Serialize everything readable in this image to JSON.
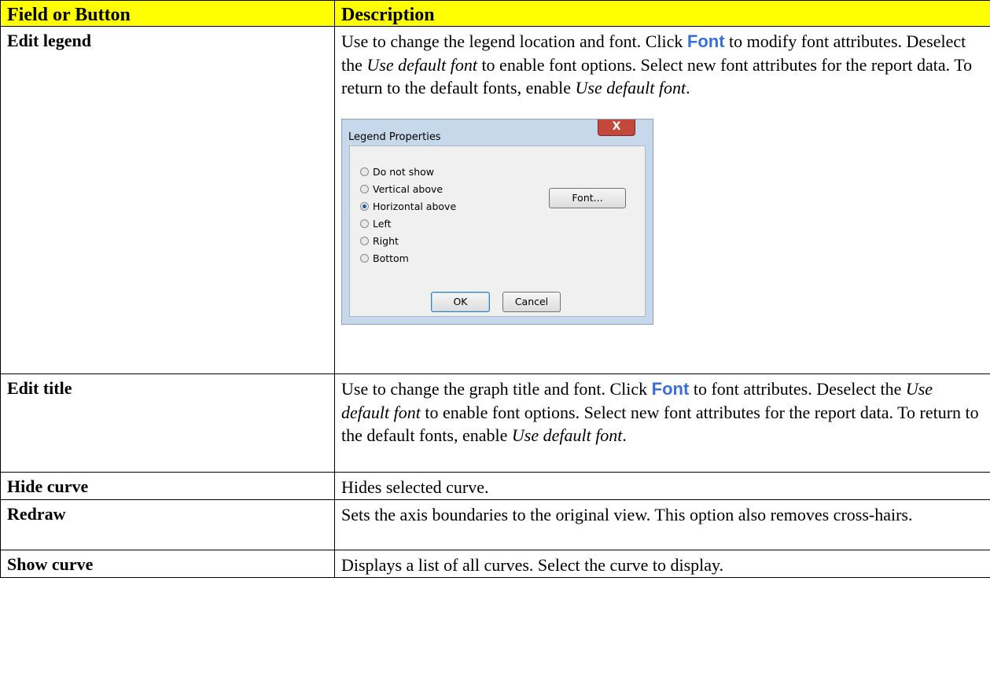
{
  "header": {
    "col1": "Field or Button",
    "col2": "Description"
  },
  "rows": {
    "edit_legend": {
      "name": "Edit legend",
      "d1": "Use to change the legend location and font. Click ",
      "font": "Font",
      "d2": " to modify font attributes. Deselect the ",
      "it1": "Use default font",
      "d3": " to enable font options. Select new font attributes for the report data. To return to the default fonts, enable ",
      "it2": "Use default font",
      "d4": "."
    },
    "edit_title": {
      "name": "Edit title",
      "d1": "Use to change the graph title and font. Click ",
      "font": "Font",
      "d2": " to font attributes. Deselect the ",
      "it1": "Use default font",
      "d3": " to enable font options. Select new font attributes for the report data. To return to the default fonts, enable ",
      "it2": "Use default font",
      "d4": "."
    },
    "hide_curve": {
      "name": "Hide curve",
      "desc": "Hides selected curve."
    },
    "redraw": {
      "name": "Redraw",
      "desc": "Sets the axis boundaries to the original view. This option also removes cross-hairs."
    },
    "show_curve": {
      "name": "Show curve",
      "desc": "Displays a list of all curves. Select the curve to display."
    }
  },
  "dialog": {
    "title": "Legend Properties",
    "close": "X",
    "options": [
      "Do not show",
      "Vertical above",
      "Horizontal above",
      "Left",
      "Right",
      "Bottom"
    ],
    "selected": "Horizontal above",
    "font_button": "Font...",
    "ok_button": "OK",
    "cancel_button": "Cancel"
  },
  "colors": {
    "header_bg": "#ffff00",
    "font_link": "#3a6fd8"
  }
}
